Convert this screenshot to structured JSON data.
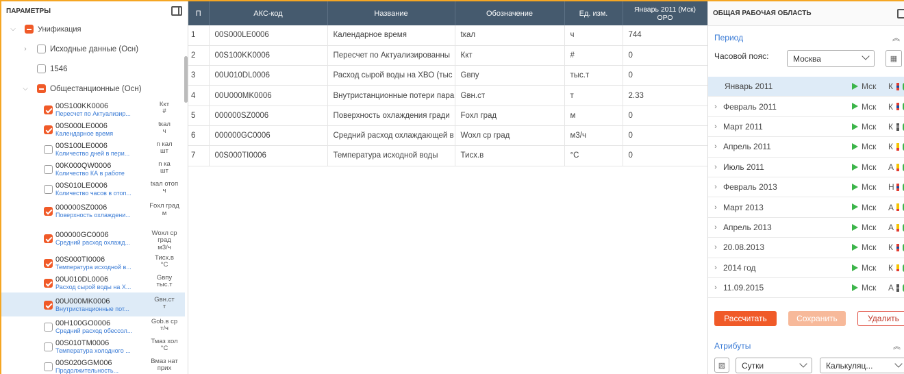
{
  "left": {
    "title": "ПАРАМЕТРЫ",
    "root": "Унификация",
    "groups": [
      {
        "label": "Исходные данные (Осн)"
      },
      {
        "label": "1546"
      },
      {
        "label": "Общестанционные (Осн)"
      }
    ],
    "items": [
      {
        "code": "00S100KK0006",
        "desc": "Пересчет по Актуализир...",
        "u1": "Ккт",
        "u2": "#",
        "checked": true
      },
      {
        "code": "00S000LE0006",
        "desc": "Календарное время",
        "u1": "tкал",
        "u2": "ч",
        "checked": true
      },
      {
        "code": "00S100LE0006",
        "desc": "Количество дней в пери...",
        "u1": "n кал",
        "u2": "шт",
        "checked": false
      },
      {
        "code": "00K000QW0006",
        "desc": "Количество КА в работе",
        "u1": "n ка",
        "u2": "шт",
        "checked": false
      },
      {
        "code": "00S010LE0006",
        "desc": "Количество часов в отоп...",
        "u1": "tкал отоп",
        "u2": "ч",
        "checked": false
      },
      {
        "code": "000000SZ0006",
        "desc": "Поверхность охлаждени...",
        "u1": "Fохл град",
        "u2": "м",
        "checked": true
      },
      {
        "code": "000000GC0006",
        "desc": "Средний расход охлажд...",
        "u1": "Wохл ср град",
        "u2": "м3/ч",
        "checked": true
      },
      {
        "code": "00S000TI0006",
        "desc": "Температура исходной в...",
        "u1": "Тисх.в",
        "u2": "°С",
        "checked": true
      },
      {
        "code": "00U010DL0006",
        "desc": "Расход сырой воды на Х...",
        "u1": "Gвпу",
        "u2": "тыс.т",
        "checked": true
      },
      {
        "code": "00U000MK0006",
        "desc": "Внутристанционные пот...",
        "u1": "Gвн.ст",
        "u2": "т",
        "checked": true
      },
      {
        "code": "00H100GO0006",
        "desc": "Средний расход обессол...",
        "u1": "Gob.в ср",
        "u2": "т/ч",
        "checked": false
      },
      {
        "code": "00S010TM0006",
        "desc": "Температура холодного ...",
        "u1": "Тмаз хол",
        "u2": "°С",
        "checked": false
      },
      {
        "code": "00S020GGM006",
        "desc": "Продолжительность...",
        "u1": "Вмаз нат",
        "u2": "прих",
        "checked": false
      }
    ]
  },
  "table": {
    "headers": [
      "П",
      "АКС-код",
      "Название",
      "Обозначение",
      "Ед. изм.",
      "Январь 2011 (Мск)",
      "ОРО"
    ],
    "rows": [
      {
        "n": "1",
        "code": "00S000LE0006",
        "name": "Календарное время",
        "sym": "tкал",
        "unit": "ч",
        "val": "744"
      },
      {
        "n": "2",
        "code": "00S100KK0006",
        "name": "Пересчет по Актуализированны",
        "sym": "Ккт",
        "unit": "#",
        "val": "0"
      },
      {
        "n": "3",
        "code": "00U010DL0006",
        "name": "Расход сырой воды на ХВО (тыс",
        "sym": "Gвпу",
        "unit": "тыс.т",
        "val": "0"
      },
      {
        "n": "4",
        "code": "00U000MK0006",
        "name": "Внутристанционные потери пара",
        "sym": "Gвн.ст",
        "unit": "т",
        "val": "2.33"
      },
      {
        "n": "5",
        "code": "000000SZ0006",
        "name": "Поверхность охлаждения гради",
        "sym": "Fохл град",
        "unit": "м",
        "val": "0"
      },
      {
        "n": "6",
        "code": "000000GC0006",
        "name": "Средний расход охлаждающей в",
        "sym": "Wохл ср град",
        "unit": "м3/ч",
        "val": "0"
      },
      {
        "n": "7",
        "code": "00S000TI0006",
        "name": "Температура исходной воды",
        "sym": "Тисх.в",
        "unit": "°С",
        "val": "0"
      }
    ]
  },
  "right": {
    "title": "ОБЩАЯ РАБОЧАЯ ОБЛАСТЬ",
    "period_label": "Период",
    "tz_label": "Часовой пояс:",
    "tz_value": "Москва",
    "periods": [
      {
        "name": "Январь 2011",
        "tz": "Мск",
        "letter": "К",
        "flag": "ru",
        "selected": true,
        "expandable": false
      },
      {
        "name": "Февраль 2011",
        "tz": "Мск",
        "letter": "К",
        "flag": "ru",
        "selected": false,
        "expandable": true
      },
      {
        "name": "Март 2011",
        "tz": "Мск",
        "letter": "К",
        "flag": "grey",
        "selected": false,
        "expandable": true
      },
      {
        "name": "Апрель 2011",
        "tz": "Мск",
        "letter": "К",
        "flag": "yellow",
        "selected": false,
        "expandable": true
      },
      {
        "name": "Июль 2011",
        "tz": "Мск",
        "letter": "А",
        "flag": "yellow",
        "selected": false,
        "expandable": true
      },
      {
        "name": "Февраль 2013",
        "tz": "Мск",
        "letter": "Н",
        "flag": "ru",
        "selected": false,
        "expandable": true
      },
      {
        "name": "Март 2013",
        "tz": "Мск",
        "letter": "А",
        "flag": "yellow",
        "selected": false,
        "expandable": true
      },
      {
        "name": "Апрель 2013",
        "tz": "Мск",
        "letter": "А",
        "flag": "yellow",
        "selected": false,
        "expandable": true
      },
      {
        "name": "20.08.2013",
        "tz": "Мск",
        "letter": "К",
        "flag": "ru",
        "selected": false,
        "expandable": true
      },
      {
        "name": "2014 год",
        "tz": "Мск",
        "letter": "К",
        "flag": "yellow",
        "selected": false,
        "expandable": true
      },
      {
        "name": "11.09.2015",
        "tz": "Мск",
        "letter": "А",
        "flag": "grey",
        "selected": false,
        "expandable": true
      }
    ],
    "buttons": {
      "calc": "Рассчитать",
      "save": "Сохранить",
      "delete": "Удалить"
    },
    "attrs_label": "Атрибуты",
    "attr_select1": "Сутки",
    "attr_select2": "Калькуляц..."
  }
}
